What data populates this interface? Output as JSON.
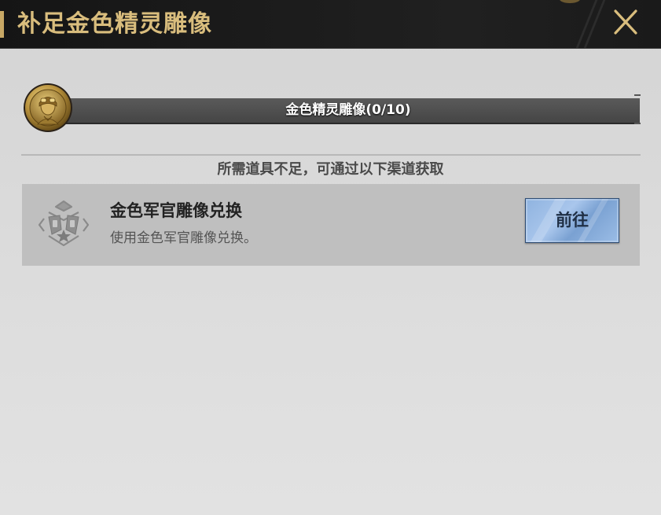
{
  "dialog": {
    "title": "补足金色精灵雕像",
    "close_icon": "close-x-icon"
  },
  "item": {
    "name_with_count": "金色精灵雕像(0/10)",
    "icon": "golden-pilot-medal-icon"
  },
  "hint_text": "所需道具不足，可通过以下渠道获取",
  "sources": [
    {
      "icon": "officer-emblem-icon",
      "title": "金色军官雕像兑换",
      "description": "使用金色军官雕像兑换。",
      "button_label": "前往"
    }
  ],
  "colors": {
    "title_gold": "#d9bd7d",
    "header_bg": "#1c1c1c",
    "panel_bg": "#d9d9d9",
    "button_blue": "#9bbde6"
  }
}
